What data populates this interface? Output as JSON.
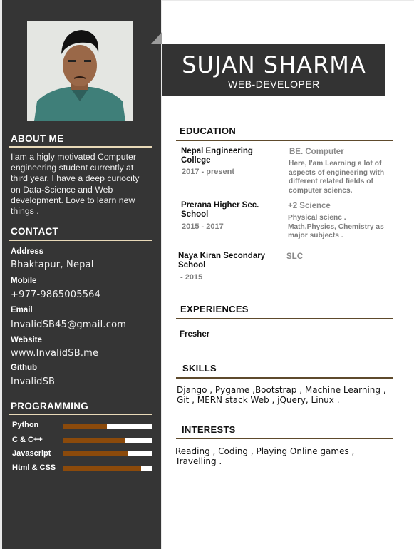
{
  "profile": {
    "name": "SUJAN SHARMA",
    "role": "WEB-DEVELOPER"
  },
  "about": {
    "title": "ABOUT ME",
    "text": "I'am a higly motivated Computer engineering student currently at third year. I have a deep curiocity on Data-Science and Web development. Love to learn new things ."
  },
  "contact": {
    "title": "CONTACT",
    "items": [
      {
        "label": "Address",
        "value": "Bhaktapur,  Nepal"
      },
      {
        "label": "Mobile",
        "value": "+977-9865005564"
      },
      {
        "label": "Email",
        "value": "InvalidSB45@gmail.com"
      },
      {
        "label": "Website",
        "value": "www.InvalidSB.me"
      },
      {
        "label": "Github",
        "value": "InvalidSB"
      }
    ]
  },
  "programming": {
    "title": "PROGRAMMING",
    "items": [
      {
        "name": "Python",
        "level": 0.49
      },
      {
        "name": "C & C++",
        "level": 0.69
      },
      {
        "name": "Javascript",
        "level": 0.73
      },
      {
        "name": "Html & CSS",
        "level": 0.88
      }
    ]
  },
  "education": {
    "title": "EDUCATION",
    "items": [
      {
        "institution": "Nepal Engineering College",
        "period": "2017 - present",
        "degree": "BE. Computer",
        "description": "Here, I'am Learning  a lot of aspects of engineering with different related fields of computer sciencs."
      },
      {
        "institution": "Prerana Higher  Sec. School",
        "period": "2015 - 2017",
        "degree": "+2  Science",
        "description": "Physical scienc . Math,Physics, Chemistry  as major subjects ."
      },
      {
        "institution": "Naya Kiran Secondary School",
        "period": " - 2015",
        "degree": "SLC",
        "description": ""
      }
    ]
  },
  "experiences": {
    "title": "EXPERIENCES",
    "text": "Fresher"
  },
  "skills": {
    "title": "SKILLS",
    "text": "Django , Pygame ,Bootstrap , Machine Learning , Git , MERN stack Web , jQuery, Linux ."
  },
  "interests": {
    "title": "INTERESTS",
    "text": "Reading , Coding , Playing Online games , Travelling ."
  },
  "colors": {
    "sidebar": "#353535",
    "bar_fill": "#8b4a0b",
    "accent_line": "#e8d9b8"
  }
}
